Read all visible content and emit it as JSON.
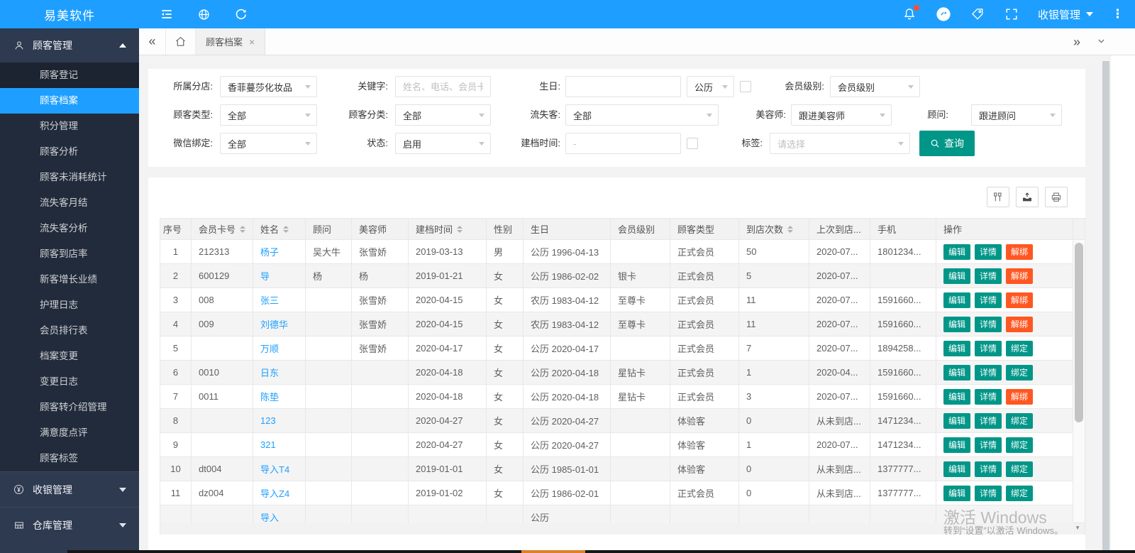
{
  "brand": {
    "name": "易美软件",
    "primary_color": "#1E9FFF",
    "teal": "#009688",
    "orange": "#FF5722",
    "link_blue": "#1E9FFF"
  },
  "topbar": {
    "user_menu": "收银管理",
    "icons": [
      "collapse-menu-icon",
      "globe-icon",
      "refresh-icon",
      "bell-icon",
      "badge-circle-icon",
      "tag-icon",
      "fullscreen-icon",
      "more-icon"
    ]
  },
  "tabbar": {
    "active_tab": "顾客档案",
    "icons": [
      "double-left-icon",
      "home-icon",
      "close-icon",
      "double-right-icon",
      "chevron-down-icon"
    ]
  },
  "sidebar": {
    "active_item": "顾客档案",
    "groups": [
      {
        "label": "顾客管理",
        "icon": "user-icon",
        "expanded": true,
        "items": [
          "顾客登记",
          "顾客档案",
          "积分管理",
          "顾客分析",
          "顾客未消耗统计",
          "流失客月结",
          "流失客分析",
          "顾客到店率",
          "新客增长业绩",
          "护理日志",
          "会员排行表",
          "档案变更",
          "变更日志",
          "顾客转介绍管理",
          "满意度点评",
          "顾客标签"
        ]
      },
      {
        "label": "收银管理",
        "icon": "yen-icon",
        "expanded": false,
        "items": []
      },
      {
        "label": "仓库管理",
        "icon": "warehouse-icon",
        "expanded": false,
        "items": []
      }
    ]
  },
  "filters": {
    "branch": {
      "label": "所属分店:",
      "value": "香菲蔓莎化妆品"
    },
    "keyword": {
      "label": "关键字:",
      "placeholder": "姓名、电话、会员卡"
    },
    "birthday": {
      "label": "生日:",
      "value": "",
      "calendar": "公历"
    },
    "level": {
      "label": "会员级别:",
      "value": "会员级别"
    },
    "customer_type": {
      "label": "顾客类型:",
      "value": "全部"
    },
    "customer_category": {
      "label": "顾客分类:",
      "value": "全部"
    },
    "churn": {
      "label": "流失客:",
      "value": "全部"
    },
    "beautician": {
      "label": "美容师:",
      "value": "跟进美容师"
    },
    "advisor": {
      "label": "顾问:",
      "value": "跟进顾问"
    },
    "wechat": {
      "label": "微信绑定:",
      "value": "全部"
    },
    "status": {
      "label": "状态:",
      "value": "启用"
    },
    "created": {
      "label": "建档时间:",
      "placeholder": "-"
    },
    "tags": {
      "label": "标签:",
      "placeholder": "请选择"
    },
    "search": "查询"
  },
  "toolbar_icons": [
    "column-settings-icon",
    "export-icon",
    "print-icon"
  ],
  "table": {
    "columns": [
      {
        "key": "num",
        "label": "序号",
        "sortable": false
      },
      {
        "key": "card",
        "label": "会员卡号",
        "sortable": true
      },
      {
        "key": "name",
        "label": "姓名",
        "sortable": true
      },
      {
        "key": "advisor",
        "label": "顾问",
        "sortable": false
      },
      {
        "key": "beautician",
        "label": "美容师",
        "sortable": false
      },
      {
        "key": "created",
        "label": "建档时间",
        "sortable": true
      },
      {
        "key": "gender",
        "label": "性别",
        "sortable": false
      },
      {
        "key": "birthday",
        "label": "生日",
        "sortable": false
      },
      {
        "key": "level",
        "label": "会员级别",
        "sortable": false
      },
      {
        "key": "type",
        "label": "顾客类型",
        "sortable": false
      },
      {
        "key": "visits",
        "label": "到店次数",
        "sortable": true
      },
      {
        "key": "last_visit",
        "label": "上次到店...",
        "sortable": false
      },
      {
        "key": "phone",
        "label": "手机",
        "sortable": false
      },
      {
        "key": "actions",
        "label": "操作",
        "sortable": false
      }
    ],
    "rows": [
      {
        "num": "1",
        "card": "212313",
        "name": "杨子",
        "advisor": "吴大牛",
        "beautician": "张雪娇",
        "created": "2019-03-13",
        "gender": "男",
        "birthday": "公历 1996-04-13",
        "level": "",
        "type": "正式会员",
        "visits": "50",
        "last_visit": "2020-07...",
        "phone": "1801234...",
        "actions": [
          {
            "label": "编辑",
            "style": "teal"
          },
          {
            "label": "详情",
            "style": "teal"
          },
          {
            "label": "解绑",
            "style": "orange"
          }
        ]
      },
      {
        "num": "2",
        "card": "600129",
        "name": "导",
        "advisor": "杨",
        "beautician": "杨",
        "created": "2019-01-21",
        "gender": "女",
        "birthday": "公历 1986-02-02",
        "level": "银卡",
        "type": "正式会员",
        "visits": "5",
        "last_visit": "2020-07...",
        "phone": "",
        "actions": [
          {
            "label": "编辑",
            "style": "teal"
          },
          {
            "label": "详情",
            "style": "teal"
          },
          {
            "label": "解绑",
            "style": "orange"
          }
        ]
      },
      {
        "num": "3",
        "card": "008",
        "name": "张三",
        "advisor": "",
        "beautician": "张雪娇",
        "created": "2020-04-15",
        "gender": "女",
        "birthday": "农历 1983-04-12",
        "level": "至尊卡",
        "type": "正式会员",
        "visits": "11",
        "last_visit": "2020-07...",
        "phone": "1591660...",
        "actions": [
          {
            "label": "编辑",
            "style": "teal"
          },
          {
            "label": "详情",
            "style": "teal"
          },
          {
            "label": "解绑",
            "style": "orange"
          }
        ]
      },
      {
        "num": "4",
        "card": "009",
        "name": "刘德华",
        "advisor": "",
        "beautician": "张雪娇",
        "created": "2020-04-15",
        "gender": "女",
        "birthday": "农历 1983-04-12",
        "level": "至尊卡",
        "type": "正式会员",
        "visits": "11",
        "last_visit": "2020-07...",
        "phone": "1591660...",
        "actions": [
          {
            "label": "编辑",
            "style": "teal"
          },
          {
            "label": "详情",
            "style": "teal"
          },
          {
            "label": "解绑",
            "style": "orange"
          }
        ]
      },
      {
        "num": "5",
        "card": "",
        "name": "万顺",
        "advisor": "",
        "beautician": "张雪娇",
        "created": "2020-04-17",
        "gender": "女",
        "birthday": "公历 2020-04-17",
        "level": "",
        "type": "正式会员",
        "visits": "7",
        "last_visit": "2020-07...",
        "phone": "1894258...",
        "actions": [
          {
            "label": "编辑",
            "style": "teal"
          },
          {
            "label": "详情",
            "style": "teal"
          },
          {
            "label": "绑定",
            "style": "teal"
          }
        ]
      },
      {
        "num": "6",
        "card": "0010",
        "name": "日东",
        "advisor": "",
        "beautician": "",
        "created": "2020-04-18",
        "gender": "女",
        "birthday": "公历 2020-04-18",
        "level": "星钻卡",
        "type": "正式会员",
        "visits": "1",
        "last_visit": "2020-04...",
        "phone": "1591660...",
        "actions": [
          {
            "label": "编辑",
            "style": "teal"
          },
          {
            "label": "详情",
            "style": "teal"
          },
          {
            "label": "绑定",
            "style": "teal"
          }
        ]
      },
      {
        "num": "7",
        "card": "0011",
        "name": "陈垫",
        "advisor": "",
        "beautician": "",
        "created": "2020-04-18",
        "gender": "女",
        "birthday": "公历 2020-04-18",
        "level": "星钻卡",
        "type": "正式会员",
        "visits": "3",
        "last_visit": "2020-07...",
        "phone": "1591660...",
        "actions": [
          {
            "label": "编辑",
            "style": "teal"
          },
          {
            "label": "详情",
            "style": "teal"
          },
          {
            "label": "解绑",
            "style": "orange"
          }
        ]
      },
      {
        "num": "8",
        "card": "",
        "name": "123",
        "advisor": "",
        "beautician": "",
        "created": "2020-04-27",
        "gender": "女",
        "birthday": "公历 2020-04-27",
        "level": "",
        "type": "体验客",
        "visits": "0",
        "last_visit": "从未到店...",
        "phone": "1471234...",
        "actions": [
          {
            "label": "编辑",
            "style": "teal"
          },
          {
            "label": "详情",
            "style": "teal"
          },
          {
            "label": "绑定",
            "style": "teal"
          }
        ]
      },
      {
        "num": "9",
        "card": "",
        "name": "321",
        "advisor": "",
        "beautician": "",
        "created": "2020-04-27",
        "gender": "女",
        "birthday": "公历 2020-04-27",
        "level": "",
        "type": "体验客",
        "visits": "1",
        "last_visit": "2020-07...",
        "phone": "1471234...",
        "actions": [
          {
            "label": "编辑",
            "style": "teal"
          },
          {
            "label": "详情",
            "style": "teal"
          },
          {
            "label": "绑定",
            "style": "teal"
          }
        ]
      },
      {
        "num": "10",
        "card": "dt004",
        "name": "导入T4",
        "advisor": "",
        "beautician": "",
        "created": "2019-01-01",
        "gender": "女",
        "birthday": "公历 1985-01-01",
        "level": "",
        "type": "体验客",
        "visits": "0",
        "last_visit": "从未到店...",
        "phone": "1377777...",
        "actions": [
          {
            "label": "编辑",
            "style": "teal"
          },
          {
            "label": "详情",
            "style": "teal"
          },
          {
            "label": "绑定",
            "style": "teal"
          }
        ]
      },
      {
        "num": "11",
        "card": "dz004",
        "name": "导入Z4",
        "advisor": "",
        "beautician": "",
        "created": "2019-01-02",
        "gender": "女",
        "birthday": "公历 1986-02-01",
        "level": "",
        "type": "正式会员",
        "visits": "0",
        "last_visit": "从未到店...",
        "phone": "1377777...",
        "actions": [
          {
            "label": "编辑",
            "style": "teal"
          },
          {
            "label": "详情",
            "style": "teal"
          },
          {
            "label": "绑定",
            "style": "teal"
          }
        ]
      },
      {
        "num": "",
        "card": "",
        "name": "导入",
        "advisor": "",
        "beautician": "",
        "created": "",
        "gender": "",
        "birthday": "公历",
        "level": "",
        "type": "",
        "visits": "",
        "last_visit": "",
        "phone": "",
        "actions": []
      }
    ]
  },
  "watermark": {
    "line1": "激活 Windows",
    "line2": "转到“设置”以激活 Windows。"
  }
}
